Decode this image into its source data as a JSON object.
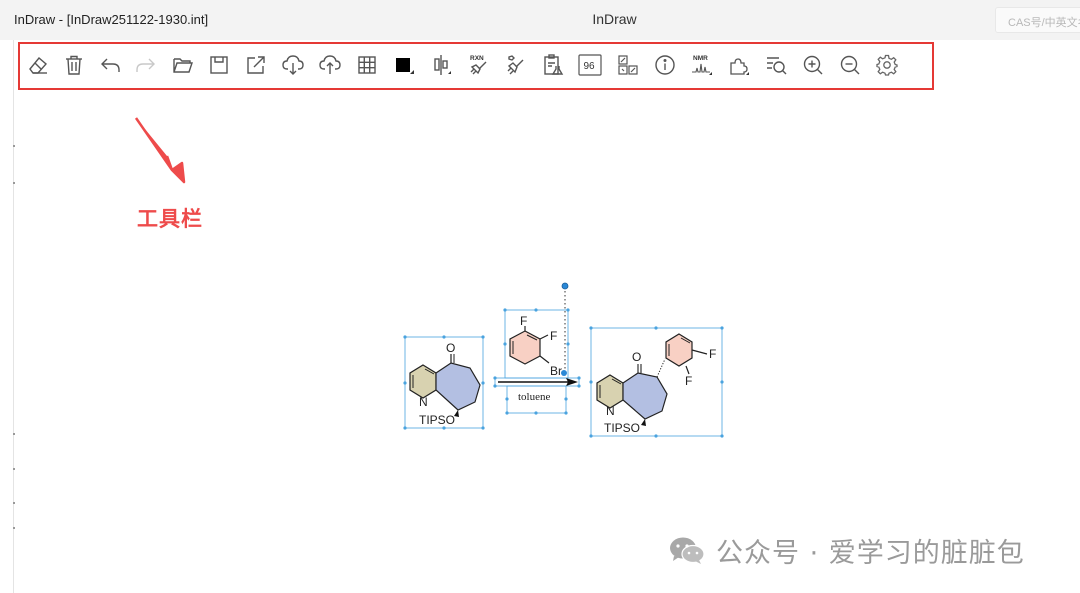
{
  "window": {
    "document_title": "InDraw - [InDraw251122-1930.int]",
    "app_title": "InDraw",
    "search_placeholder": "CAS号/中英文名"
  },
  "toolbar": {
    "tools": [
      {
        "name": "eraser-tool",
        "icon": "eraser-icon"
      },
      {
        "name": "delete-tool",
        "icon": "trash-icon"
      },
      {
        "name": "undo-tool",
        "icon": "undo-icon"
      },
      {
        "name": "redo-tool",
        "icon": "redo-icon",
        "disabled": true
      },
      {
        "name": "open-tool",
        "icon": "folder-icon"
      },
      {
        "name": "save-tool",
        "icon": "save-icon"
      },
      {
        "name": "export-tool",
        "icon": "export-icon"
      },
      {
        "name": "cloud-download-tool",
        "icon": "cloud-download-icon"
      },
      {
        "name": "cloud-upload-tool",
        "icon": "cloud-upload-icon"
      },
      {
        "name": "grid-tool",
        "icon": "grid-icon"
      },
      {
        "name": "color-tool",
        "icon": "color-square-icon"
      },
      {
        "name": "align-tool",
        "icon": "align-icon"
      },
      {
        "name": "reaction-clean-tool",
        "icon": "rxn-broom-icon",
        "text": "RXN"
      },
      {
        "name": "structure-clean-tool",
        "icon": "broom-icon"
      },
      {
        "name": "clipboard-tool",
        "icon": "clipboard-flask-icon"
      },
      {
        "name": "number-tool",
        "icon": "number-box-icon",
        "text": "96"
      },
      {
        "name": "template-tool",
        "icon": "template-grid-icon"
      },
      {
        "name": "info-tool",
        "icon": "info-icon"
      },
      {
        "name": "nmr-tool",
        "icon": "nmr-spectrum-icon",
        "text": "NMR"
      },
      {
        "name": "plugin-tool",
        "icon": "puzzle-icon"
      },
      {
        "name": "search-structure-tool",
        "icon": "list-search-icon"
      },
      {
        "name": "zoom-in-tool",
        "icon": "zoom-in-icon"
      },
      {
        "name": "zoom-out-tool",
        "icon": "zoom-out-icon"
      },
      {
        "name": "settings-tool",
        "icon": "gear-icon"
      }
    ]
  },
  "annotation": {
    "label": "工具栏",
    "color": "#e53935"
  },
  "reaction": {
    "reactant": {
      "oxygen": "O",
      "nitrogen": "N",
      "protecting_group": "TIPSO"
    },
    "reagent": {
      "f1": "F",
      "f2": "F",
      "br": "Br",
      "solvent": "toluene"
    },
    "product": {
      "oxygen": "O",
      "nitrogen": "N",
      "f1": "F",
      "f2": "F",
      "protecting_group": "TIPSO"
    },
    "colors": {
      "pyridine_fill": "#d8d2b0",
      "cycloheptane_fill": "#b3bfe2",
      "aryl_fill": "#f8d0c4",
      "selection": "#4aa3df"
    }
  },
  "watermark": {
    "text": "公众号 · 爱学习的脏脏包"
  }
}
